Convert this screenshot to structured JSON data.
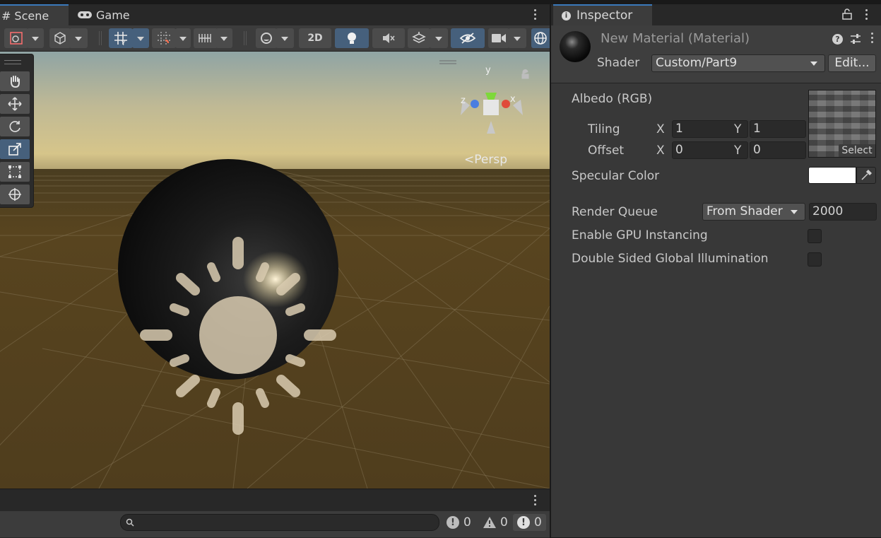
{
  "scene_window": {
    "tabs": [
      {
        "label": "Scene",
        "icon": "hash-icon"
      },
      {
        "label": "Game",
        "icon": "gamepad-icon"
      }
    ],
    "toolbar": {
      "mode_2d_label": "2D"
    },
    "gizmo": {
      "axis_y": "y",
      "axis_x": "x",
      "axis_z": "z",
      "projection_label": "Persp"
    }
  },
  "console_bar": {
    "search_placeholder": "",
    "info_count": "0",
    "warning_count": "0",
    "error_count": "0"
  },
  "inspector": {
    "tab_label": "Inspector",
    "material_name": "New Material (Material)",
    "shader_label": "Shader",
    "shader_value": "Custom/Part9",
    "edit_button": "Edit...",
    "albedo_label": "Albedo (RGB)",
    "tiling_label": "Tiling",
    "offset_label": "Offset",
    "x_label": "X",
    "y_label": "Y",
    "tiling_x": "1",
    "tiling_y": "1",
    "offset_x": "0",
    "offset_y": "0",
    "select_label": "Select",
    "specular_label": "Specular Color",
    "specular_color": "#ffffff",
    "render_queue_label": "Render Queue",
    "render_queue_mode": "From Shader",
    "render_queue_value": "2000",
    "gpu_instancing_label": "Enable GPU Instancing",
    "gpu_instancing_checked": false,
    "double_sided_gi_label": "Double Sided Global Illumination",
    "double_sided_gi_checked": false
  }
}
